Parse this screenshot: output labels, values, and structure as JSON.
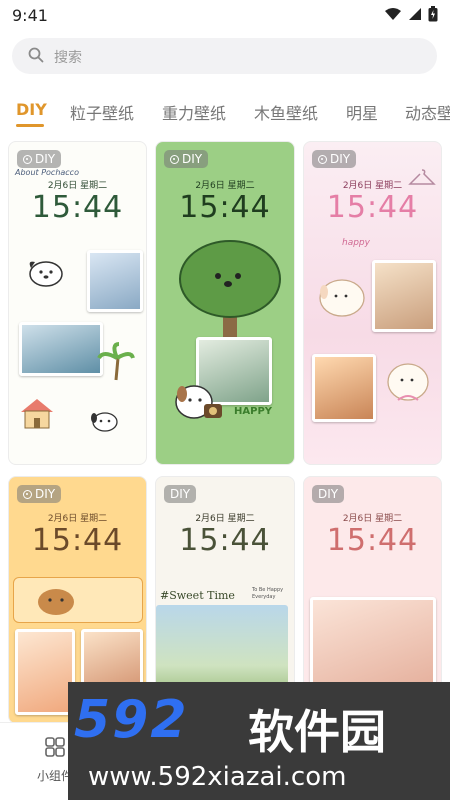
{
  "status_bar": {
    "time": "9:41",
    "icons": [
      "wifi-icon",
      "cellular-icon",
      "battery-icon"
    ]
  },
  "search": {
    "placeholder": "搜索"
  },
  "tabs": [
    {
      "label": "DIY",
      "active": true
    },
    {
      "label": "粒子壁纸",
      "active": false
    },
    {
      "label": "重力壁纸",
      "active": false
    },
    {
      "label": "木鱼壁纸",
      "active": false
    },
    {
      "label": "明星",
      "active": false
    },
    {
      "label": "动态壁",
      "active": false
    }
  ],
  "cards": [
    {
      "badge": "DIY",
      "date": "2月6日 星期二",
      "time": "15:44",
      "text": "About Pochacco"
    },
    {
      "badge": "DIY",
      "date": "2月6日 星期二",
      "time": "15:44",
      "text": "HAPPY"
    },
    {
      "badge": "DIY",
      "date": "2月6日 星期二",
      "time": "15:44",
      "text": "happy"
    },
    {
      "badge": "DIY",
      "date": "2月6日 星期二",
      "time": "15:44",
      "text": ""
    },
    {
      "badge": "DIY",
      "date": "2月6日 星期二",
      "time": "15:44",
      "text": "#Sweet Time",
      "text2": "To Be Happy Everyday"
    },
    {
      "badge": "DIY",
      "date": "2月6日 星期二",
      "time": "15:44",
      "text": ""
    }
  ],
  "bottom_nav": {
    "label": "小组件"
  },
  "watermark": {
    "logo": "592",
    "name": "软件园",
    "url": "www.592xiazai.com"
  },
  "colors": {
    "accent": "#e0962b",
    "card2_bg": "#9ccf85",
    "card3_bg": "#fbe4ec",
    "card4_bg": "#ffd98f",
    "card6_bg": "#fde9ea"
  }
}
